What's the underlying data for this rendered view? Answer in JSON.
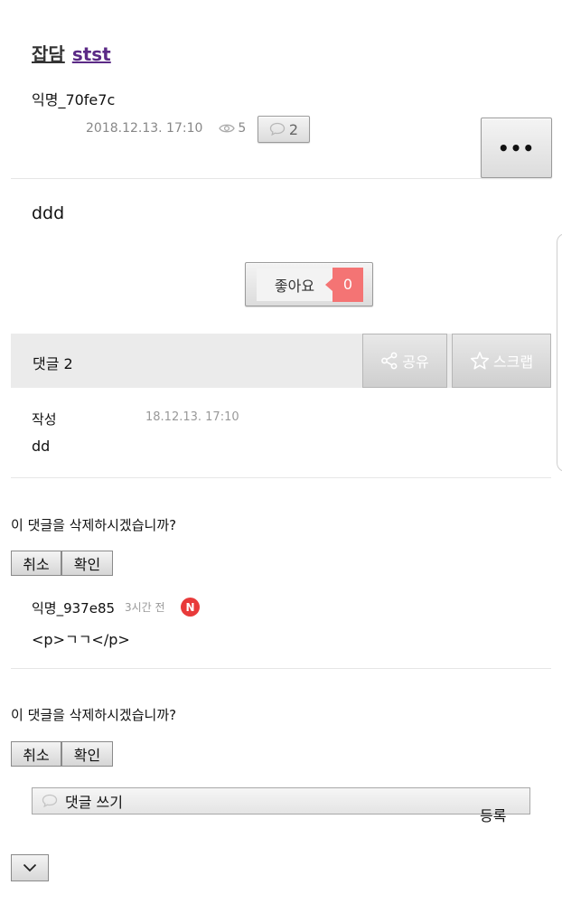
{
  "post": {
    "category": "잡담",
    "title": "stst",
    "author": "익명_70fe7c",
    "date": "2018.12.13. 17:10",
    "views": "5",
    "comment_count": "2",
    "more_label": "•••",
    "body": "ddd",
    "like_label": "좋아요",
    "like_count": "0"
  },
  "comments_bar": {
    "label": "댓글 2",
    "share_label": "공유",
    "scrap_label": "스크랩"
  },
  "comments": [
    {
      "author": "작성",
      "date": "18.12.13. 17:10",
      "text": "dd",
      "delete_prompt": "이 댓글을 삭제하시겠습니까?",
      "cancel_label": "취소",
      "confirm_label": "확인"
    },
    {
      "author": "익명_937e85",
      "time": "3시간 전",
      "new_badge": "N",
      "text": "<p>ㄱㄱ</p>",
      "delete_prompt": "이 댓글을 삭제하시겠습니까?",
      "cancel_label": "취소",
      "confirm_label": "확인"
    }
  ],
  "write": {
    "placeholder": "댓글 쓰기",
    "submit_label": "등록"
  },
  "colors": {
    "title_link": "#5b2a86",
    "like_count_bg": "#f47474",
    "new_badge_bg": "#e83a3a",
    "comments_bar_bg": "#ebebeb"
  },
  "icons": [
    "eye-icon",
    "speech-bubble-icon",
    "share-icon",
    "star-icon",
    "chevron-down-icon"
  ]
}
